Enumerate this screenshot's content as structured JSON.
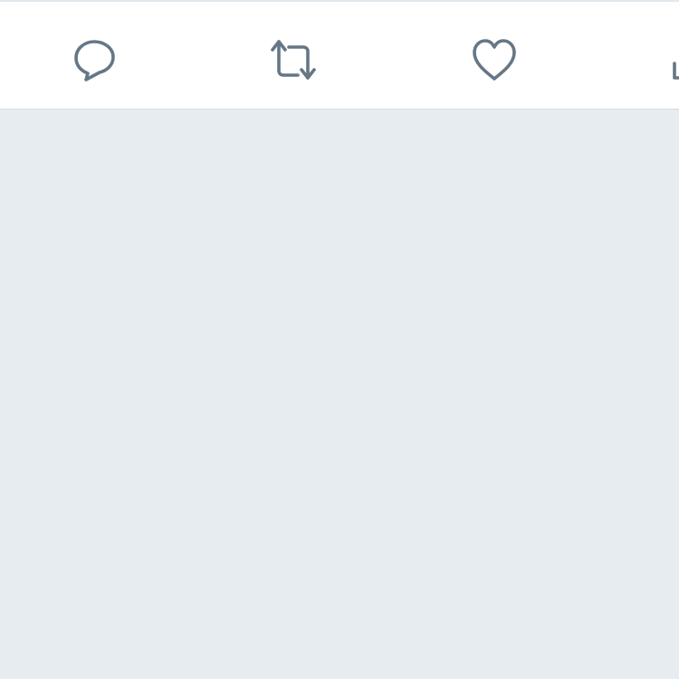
{
  "colors": {
    "background": "#e6ecf0",
    "bar_background": "#ffffff",
    "icon": "#657786",
    "divider": "#e1e8ed"
  },
  "tweet_actions": [
    {
      "id": "reply",
      "icon": "reply-speech-bubble-icon"
    },
    {
      "id": "retweet",
      "icon": "retweet-arrows-icon"
    },
    {
      "id": "like",
      "icon": "heart-icon"
    },
    {
      "id": "share",
      "icon": "share-icon"
    }
  ]
}
